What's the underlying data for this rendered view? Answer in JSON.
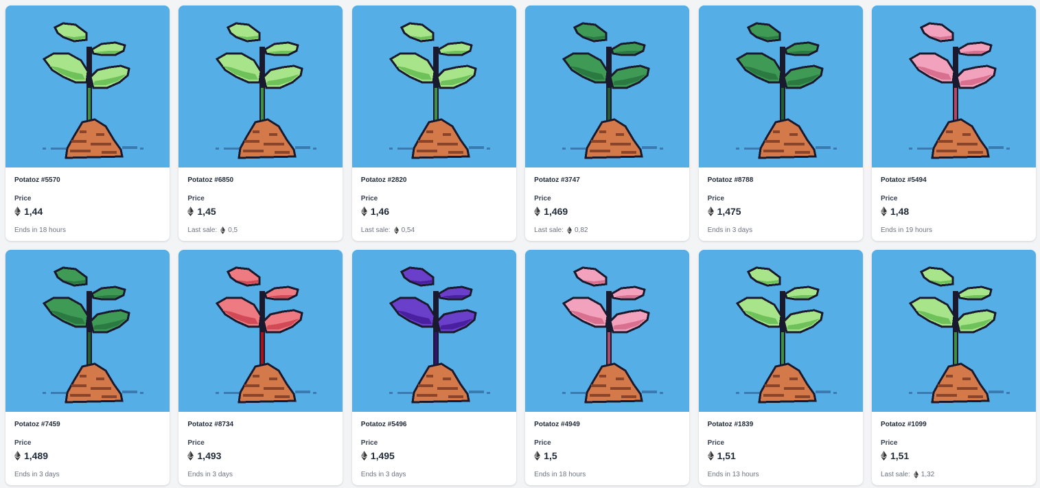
{
  "price_label": "Price",
  "last_sale_label": "Last sale:",
  "items": [
    {
      "name": "Potatoz #5570",
      "price": "1,44",
      "footer": "Ends in 18 hours",
      "last_sale": "",
      "leaf_light": "#a8e58a",
      "leaf_dark": "#6fc25a",
      "stem": "#3f8f46"
    },
    {
      "name": "Potatoz #6850",
      "price": "1,45",
      "footer": "",
      "last_sale": "0,5",
      "leaf_light": "#a8e58a",
      "leaf_dark": "#6fc25a",
      "stem": "#3f8f46"
    },
    {
      "name": "Potatoz #2820",
      "price": "1,46",
      "footer": "",
      "last_sale": "0,54",
      "leaf_light": "#a8e58a",
      "leaf_dark": "#6fc25a",
      "stem": "#3f8f46"
    },
    {
      "name": "Potatoz #3747",
      "price": "1,469",
      "footer": "",
      "last_sale": "0,82",
      "leaf_light": "#3f9a55",
      "leaf_dark": "#2a7a42",
      "stem": "#235e33"
    },
    {
      "name": "Potatoz #8788",
      "price": "1,475",
      "footer": "Ends in 3 days",
      "last_sale": "",
      "leaf_light": "#3f9a55",
      "leaf_dark": "#2a7a42",
      "stem": "#235e33"
    },
    {
      "name": "Potatoz #5494",
      "price": "1,48",
      "footer": "Ends in 19 hours",
      "last_sale": "",
      "leaf_light": "#f2a2bd",
      "leaf_dark": "#d9708f",
      "stem": "#b04a6a"
    },
    {
      "name": "Potatoz #7459",
      "price": "1,489",
      "footer": "Ends in 3 days",
      "last_sale": "",
      "leaf_light": "#3f9a55",
      "leaf_dark": "#2a7a42",
      "stem": "#235e33"
    },
    {
      "name": "Potatoz #8734",
      "price": "1,493",
      "footer": "Ends in 3 days",
      "last_sale": "",
      "leaf_light": "#ee7b82",
      "leaf_dark": "#d14a55",
      "stem": "#a3151f"
    },
    {
      "name": "Potatoz #5496",
      "price": "1,495",
      "footer": "Ends in 3 days",
      "last_sale": "",
      "leaf_light": "#6a3fc9",
      "leaf_dark": "#4a1fa0",
      "stem": "#351270"
    },
    {
      "name": "Potatoz #4949",
      "price": "1,5",
      "footer": "Ends in 18 hours",
      "last_sale": "",
      "leaf_light": "#f2a2bd",
      "leaf_dark": "#d9708f",
      "stem": "#b04a6a"
    },
    {
      "name": "Potatoz #1839",
      "price": "1,51",
      "footer": "Ends in 13 hours",
      "last_sale": "",
      "leaf_light": "#a8e58a",
      "leaf_dark": "#6fc25a",
      "stem": "#3f8f46"
    },
    {
      "name": "Potatoz #1099",
      "price": "1,51",
      "footer": "",
      "last_sale": "1,32",
      "leaf_light": "#a8e58a",
      "leaf_dark": "#6fc25a",
      "stem": "#3f8f46"
    }
  ],
  "colors": {
    "background": "#55aee5",
    "soil_light": "#d4794a",
    "soil_dark": "#8a4429",
    "outline": "#1a1a2e",
    "shadow": "#3a7ab0"
  }
}
